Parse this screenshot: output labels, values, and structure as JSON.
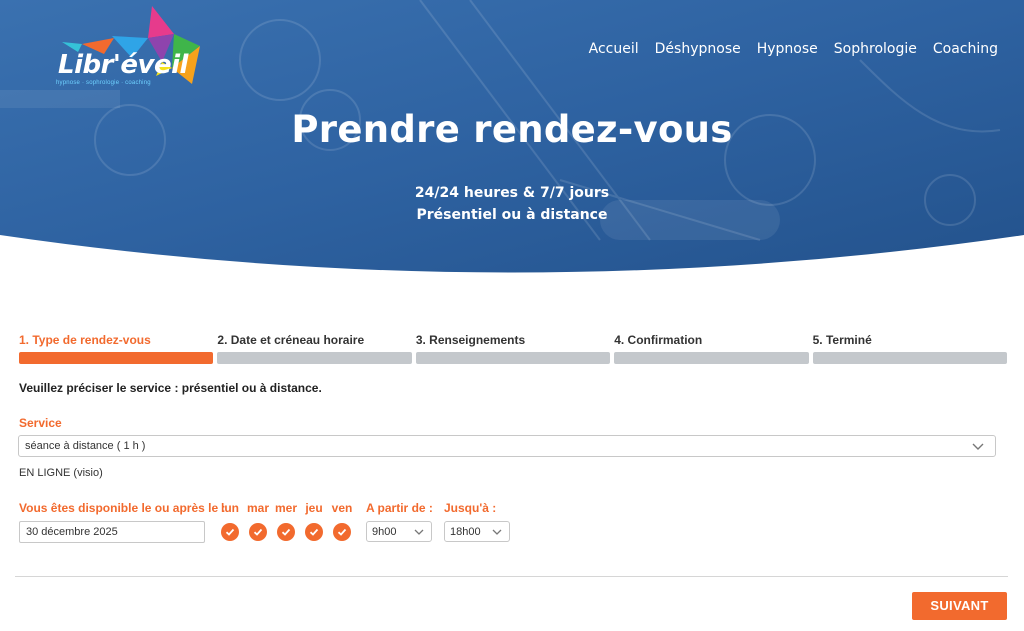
{
  "brand": {
    "logo_text": "Libr'éveil",
    "logo_subtitle": "hypnose · sophrologie · coaching"
  },
  "nav": {
    "items": [
      "Accueil",
      "Déshypnose",
      "Hypnose",
      "Sophrologie",
      "Coaching"
    ]
  },
  "hero": {
    "title": "Prendre rendez-vous",
    "line1": "24/24 heures & 7/7 jours",
    "line2": "Présentiel ou à distance"
  },
  "steps": [
    {
      "label": "1. Type de rendez-vous",
      "active": true
    },
    {
      "label": "2. Date et créneau horaire",
      "active": false
    },
    {
      "label": "3. Renseignements",
      "active": false
    },
    {
      "label": "4. Confirmation",
      "active": false
    },
    {
      "label": "5. Terminé",
      "active": false
    }
  ],
  "form": {
    "intro": "Veuillez préciser le service : présentiel ou à distance.",
    "service_label": "Service",
    "service_value": "séance à distance ( 1 h )",
    "service_note": "EN LIGNE (visio)",
    "avail_label": "Vous êtes disponible le ou après le :",
    "date_value": "30 décembre 2025",
    "days": [
      {
        "label": "lun",
        "checked": true
      },
      {
        "label": "mar",
        "checked": true
      },
      {
        "label": "mer",
        "checked": true
      },
      {
        "label": "jeu",
        "checked": true
      },
      {
        "label": "ven",
        "checked": true
      }
    ],
    "from_label": "A partir de :",
    "from_value": "9h00",
    "to_label": "Jusqu'à :",
    "to_value": "18h00",
    "next_label": "SUIVANT"
  },
  "colors": {
    "accent": "#f26a2e",
    "hero_blue": "#2f64a3",
    "bar_inactive": "#c4c8cc"
  }
}
